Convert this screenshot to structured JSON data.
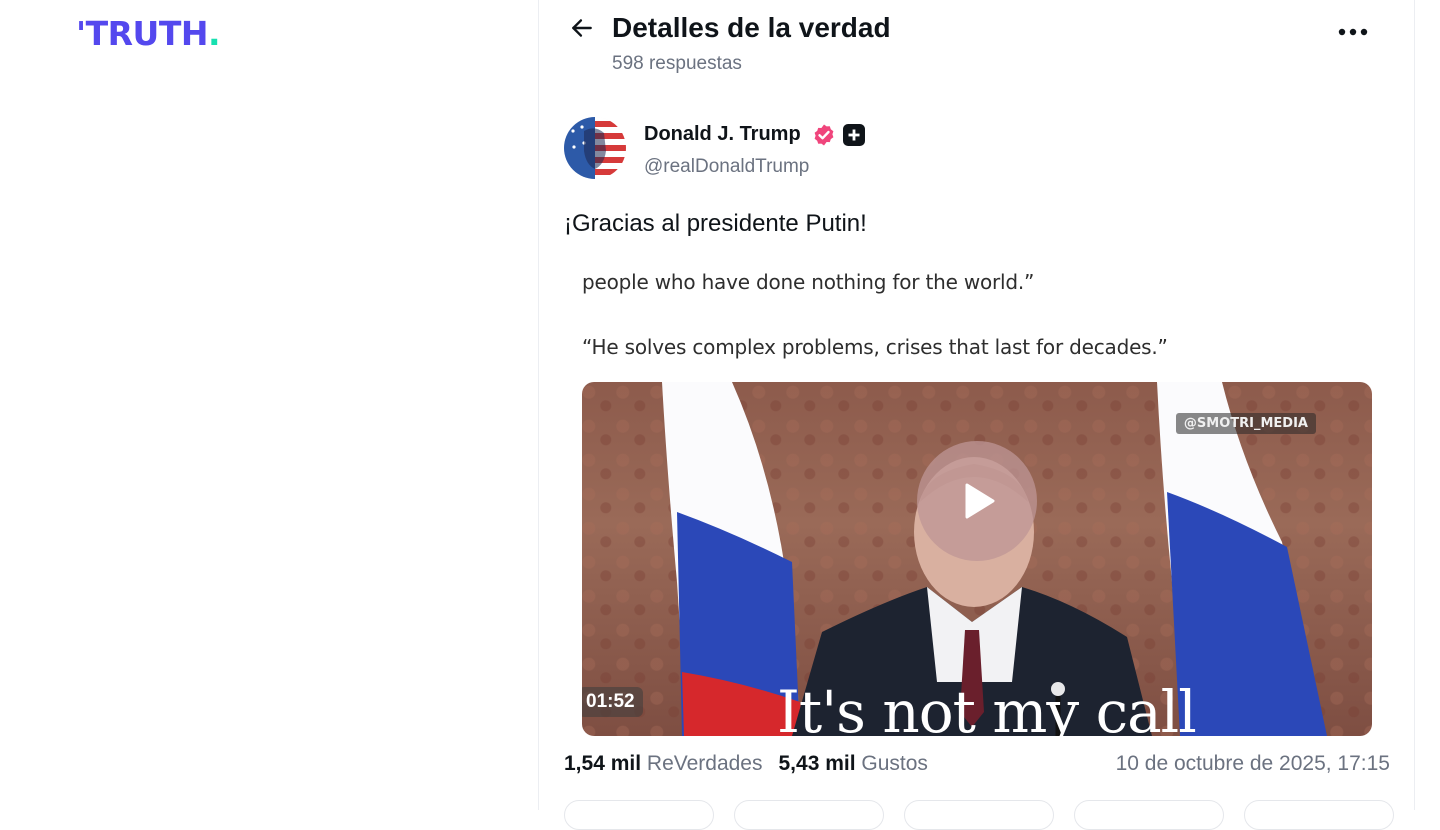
{
  "brand": {
    "logo_text": "TRUTH",
    "logo_dot": ".",
    "primary": "#5448ee",
    "accent": "#17e0b0"
  },
  "header": {
    "back_icon": "arrow-left-icon",
    "title": "Detalles de la verdad",
    "subtitle": "598 respuestas",
    "more_icon": "more-horizontal-icon"
  },
  "post": {
    "author": {
      "name": "Donald J. Trump",
      "handle": "@realDonaldTrump",
      "verified_color": "#f0457c"
    },
    "text": "¡Gracias al presidente Putin!",
    "media": {
      "caption_line_1": "people who have done nothing for the world.”",
      "caption_line_2": "“He solves complex problems, crises that last for decades.”",
      "watermark": "@SMOTRI_MEDIA",
      "duration": "01:52",
      "subtitle": "It's not my call"
    },
    "stats": {
      "reposts_count": "1,54 mil",
      "reposts_label": "ReVerdades",
      "likes_count": "5,43 mil",
      "likes_label": "Gustos",
      "timestamp": "10 de octubre de 2025, 17:15"
    }
  }
}
